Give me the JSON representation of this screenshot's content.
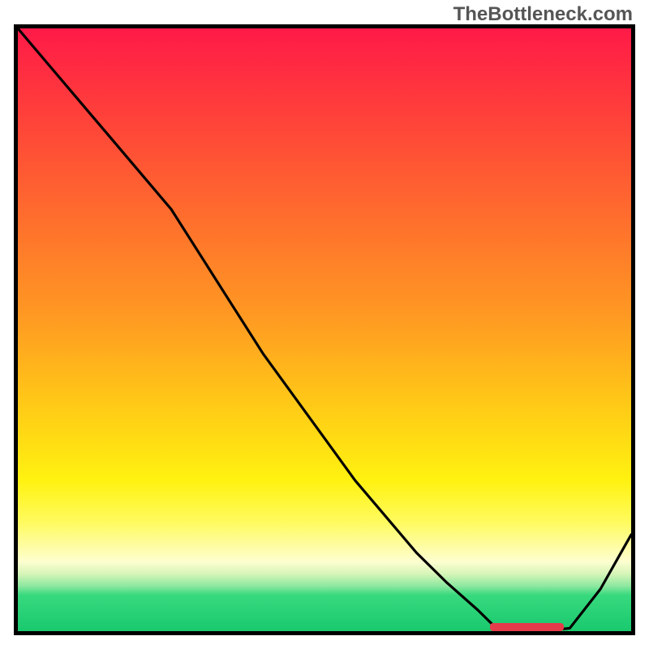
{
  "watermark": "TheBottleneck.com",
  "chart_data": {
    "type": "line",
    "title": "",
    "xlabel": "",
    "ylabel": "",
    "x": [
      0.0,
      0.05,
      0.1,
      0.15,
      0.2,
      0.25,
      0.3,
      0.35,
      0.4,
      0.45,
      0.5,
      0.55,
      0.6,
      0.65,
      0.7,
      0.75,
      0.78,
      0.82,
      0.86,
      0.9,
      0.95,
      1.0
    ],
    "values": [
      1.0,
      0.94,
      0.88,
      0.82,
      0.76,
      0.7,
      0.62,
      0.54,
      0.46,
      0.39,
      0.32,
      0.25,
      0.19,
      0.13,
      0.08,
      0.035,
      0.005,
      0.0,
      0.0,
      0.005,
      0.07,
      0.16
    ],
    "xlim": [
      0,
      1
    ],
    "ylim": [
      0,
      1
    ],
    "legend": false,
    "grid": false,
    "annotations": [
      {
        "kind": "highlight-segment",
        "x_start": 0.77,
        "x_end": 0.89,
        "y": 0.0
      }
    ],
    "background": {
      "type": "vertical-gradient",
      "stops": [
        {
          "pos": 0.0,
          "color": "#ff1a48"
        },
        {
          "pos": 0.3,
          "color": "#ff6a2e"
        },
        {
          "pos": 0.62,
          "color": "#ffc817"
        },
        {
          "pos": 0.82,
          "color": "#fffb60"
        },
        {
          "pos": 0.9,
          "color": "#d6f5b8"
        },
        {
          "pos": 1.0,
          "color": "#19c96e"
        }
      ]
    }
  }
}
